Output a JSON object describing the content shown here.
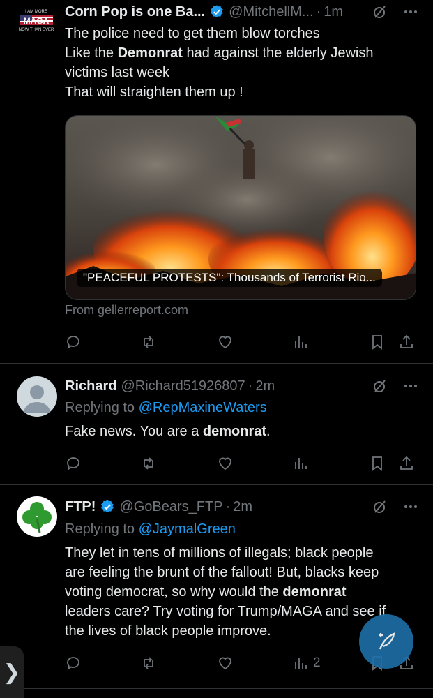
{
  "tweets": [
    {
      "name": "Corn Pop is one Ba...",
      "handle": "@MitchellM...",
      "sep": "·",
      "time": "1m",
      "avatar_text": [
        "I AM MORE",
        "MAGA",
        "NOW THAN EVER"
      ],
      "lines": [
        "The police need to get them blow torches",
        "Like the |Demonrat| had against the elderly Jewish",
        "victims last week",
        "That will straighten them up !"
      ],
      "media_caption": "\"PEACEFUL PROTESTS\": Thousands of Terrorist Rio...",
      "source": "From gellerreport.com",
      "icons": [
        "reply-icon",
        "retweet-icon",
        "like-icon",
        "views-icon",
        "bookmark-icon",
        "share-icon"
      ]
    },
    {
      "name": "Richard",
      "handle": "@Richard51926807",
      "sep": "·",
      "time": "2m",
      "replying_prefix": "Replying to ",
      "replying_to": "@RepMaxineWaters",
      "text_before": "Fake news. You are a ",
      "text_bold": "demonrat",
      "text_after": "."
    },
    {
      "name": "FTP!",
      "handle": "@GoBears_FTP",
      "sep": "·",
      "time": "2m",
      "replying_prefix": "Replying to ",
      "replying_to": "@JaymalGreen",
      "lines": [
        "They let in tens of millions of illegals; black people",
        "are feeling the brunt of the fallout! But, blacks keep",
        "voting democrat, so why would the |demonrat|",
        "leaders care? Try voting for Trump/MAGA and see if",
        "the lives of black people improve."
      ],
      "views_count": "2"
    }
  ],
  "colors": {
    "background": "#000000",
    "text": "#e7e9ea",
    "muted": "#71767b",
    "accent": "#1d9bf0",
    "divider": "#2f3336"
  },
  "side_tab_glyph": "❯"
}
